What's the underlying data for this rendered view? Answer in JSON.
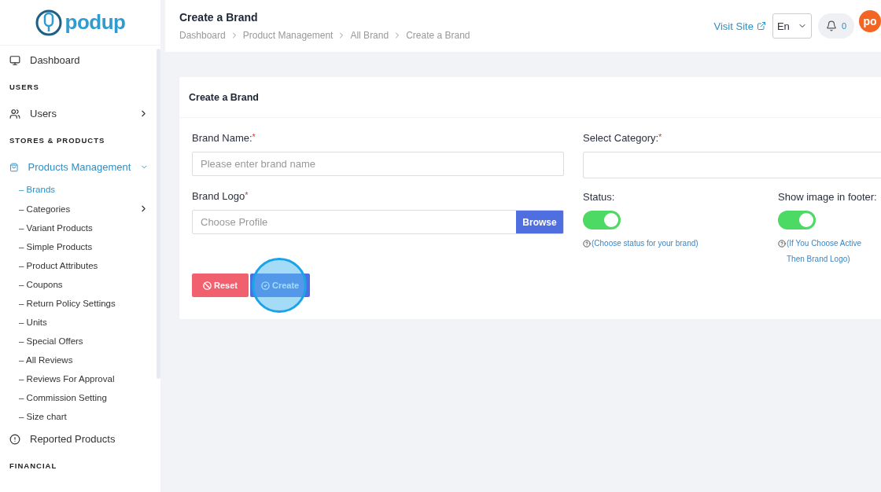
{
  "logo": {
    "text": "podup"
  },
  "sidebar": {
    "items": [
      {
        "kind": "link",
        "label": "Dashboard",
        "selected": false
      },
      {
        "kind": "heading",
        "label": "USERS"
      },
      {
        "kind": "link",
        "label": "Users",
        "selected": false,
        "expanded": false
      },
      {
        "kind": "heading",
        "label": "STORES & PRODUCTS"
      },
      {
        "kind": "link",
        "label": "Products Management",
        "selected": true,
        "expanded": true,
        "children": [
          {
            "label": "– Brands",
            "selected": true
          },
          {
            "label": "– Categories",
            "selected": false,
            "expanded": false
          },
          {
            "label": "– Variant Products",
            "selected": false
          },
          {
            "label": "– Simple Products",
            "selected": false
          },
          {
            "label": "– Product Attributes",
            "selected": false
          },
          {
            "label": "– Coupons",
            "selected": false
          },
          {
            "label": "– Return Policy Settings",
            "selected": false
          },
          {
            "label": "– Units",
            "selected": false
          },
          {
            "label": "– Special Offers",
            "selected": false
          },
          {
            "label": "– All Reviews",
            "selected": false
          },
          {
            "label": "– Reviews For Approval",
            "selected": false
          },
          {
            "label": "– Commission Setting",
            "selected": false
          },
          {
            "label": "– Size chart",
            "selected": false
          }
        ]
      },
      {
        "kind": "link",
        "label": "Reported Products",
        "selected": false
      },
      {
        "kind": "heading",
        "label": "FINANCIAL"
      }
    ]
  },
  "header": {
    "title": "Create a Brand",
    "breadcrumb": [
      "Dashboard",
      "Product Management",
      "All Brand",
      "Create a Brand"
    ],
    "visit_site": "Visit Site",
    "language": "En",
    "notifications": "0",
    "avatar": "po"
  },
  "card": {
    "title": "Create a Brand",
    "brand_name": {
      "label": "Brand Name:",
      "required_mark": "*",
      "placeholder": "Please enter brand name"
    },
    "category": {
      "label": "Select Category:",
      "required_mark": "*"
    },
    "brand_logo": {
      "label": "Brand Logo",
      "required_mark": "*",
      "placeholder": "Choose Profile",
      "button": "Browse"
    },
    "toggles": [
      {
        "label": "Status:",
        "on": true,
        "hint": "(Choose status for your brand)"
      },
      {
        "label": "Show image in footer:",
        "on": true,
        "hint": "(If You Choose Active Then Brand Logo)"
      }
    ],
    "buttons": [
      {
        "kind": "reset",
        "label": "Reset"
      },
      {
        "kind": "create",
        "label": "Create",
        "highlighted": true
      }
    ]
  }
}
